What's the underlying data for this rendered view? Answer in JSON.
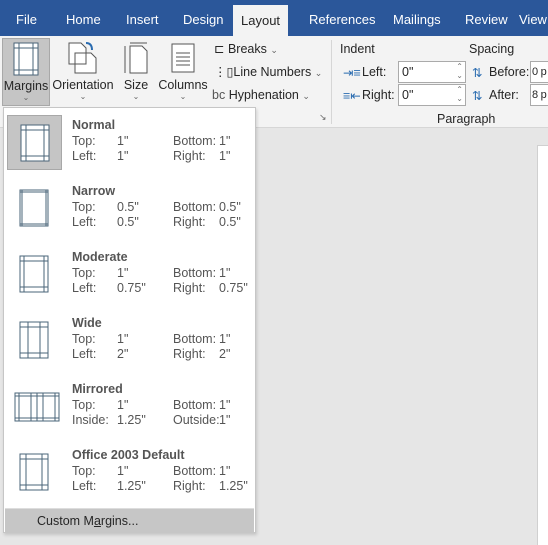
{
  "tabs": [
    "File",
    "Home",
    "Insert",
    "Design",
    "Layout",
    "References",
    "Mailings",
    "Review",
    "View"
  ],
  "active_tab": "Layout",
  "ribbon": {
    "margins": "Margins",
    "orientation": "Orientation",
    "size": "Size",
    "columns": "Columns",
    "breaks": "Breaks",
    "line_numbers": "Line Numbers",
    "hyphenation": "Hyphenation",
    "indent_label": "Indent",
    "spacing_label": "Spacing",
    "left_label": "Left:",
    "right_label": "Right:",
    "left_value": "0\"",
    "right_value": "0\"",
    "before_label": "Before:",
    "after_label": "After:",
    "before_value": "0 p",
    "after_value": "8 p",
    "paragraph_group": "Paragraph"
  },
  "margins_menu": {
    "items": [
      {
        "name": "Normal",
        "r1": [
          "Top:",
          "1\"",
          "Bottom:",
          "1\""
        ],
        "r2": [
          "Left:",
          "1\"",
          "Right:",
          "1\""
        ]
      },
      {
        "name": "Narrow",
        "r1": [
          "Top:",
          "0.5\"",
          "Bottom:",
          "0.5\""
        ],
        "r2": [
          "Left:",
          "0.5\"",
          "Right:",
          "0.5\""
        ]
      },
      {
        "name": "Moderate",
        "r1": [
          "Top:",
          "1\"",
          "Bottom:",
          "1\""
        ],
        "r2": [
          "Left:",
          "0.75\"",
          "Right:",
          "0.75\""
        ]
      },
      {
        "name": "Wide",
        "r1": [
          "Top:",
          "1\"",
          "Bottom:",
          "1\""
        ],
        "r2": [
          "Left:",
          "2\"",
          "Right:",
          "2\""
        ]
      },
      {
        "name": "Mirrored",
        "r1": [
          "Top:",
          "1\"",
          "Bottom:",
          "1\""
        ],
        "r2": [
          "Inside:",
          "1.25\"",
          "Outside:",
          "1\""
        ]
      },
      {
        "name": "Office 2003 Default",
        "r1": [
          "Top:",
          "1\"",
          "Bottom:",
          "1\""
        ],
        "r2": [
          "Left:",
          "1.25\"",
          "Right:",
          "1.25\""
        ]
      }
    ],
    "selected": "Normal",
    "custom_pre": "Custom M",
    "custom_u": "a",
    "custom_post": "rgins..."
  }
}
